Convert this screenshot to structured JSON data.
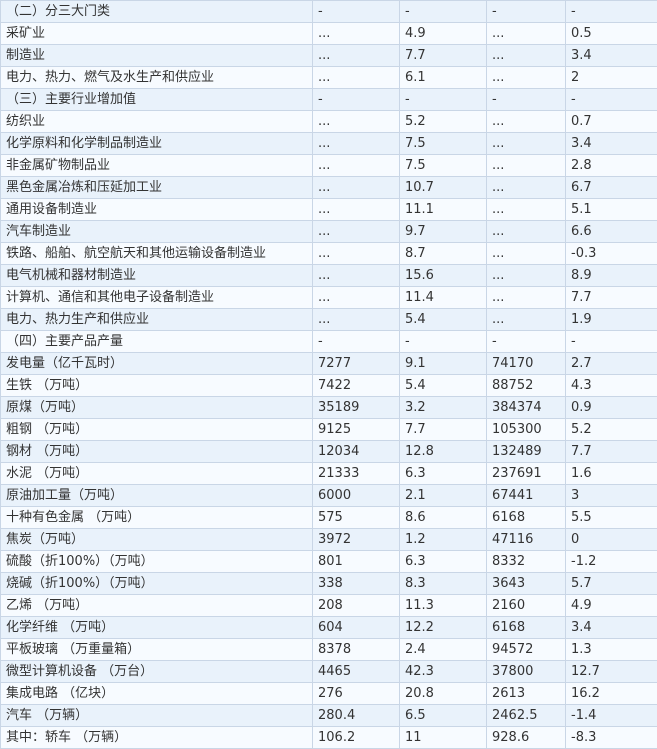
{
  "rows": [
    [
      "（二）分三大门类",
      "-",
      "-",
      "-",
      "-"
    ],
    [
      "采矿业",
      "...",
      "4.9",
      "...",
      "0.5"
    ],
    [
      "制造业",
      "...",
      "7.7",
      "...",
      "3.4"
    ],
    [
      "电力、热力、燃气及水生产和供应业",
      "...",
      "6.1",
      "...",
      "2"
    ],
    [
      "（三）主要行业增加值",
      "-",
      "-",
      "-",
      "-"
    ],
    [
      "纺织业",
      "...",
      "5.2",
      "...",
      "0.7"
    ],
    [
      "化学原料和化学制品制造业",
      "...",
      "7.5",
      "...",
      "3.4"
    ],
    [
      "非金属矿物制品业",
      "...",
      "7.5",
      "...",
      "2.8"
    ],
    [
      "黑色金属冶炼和压延加工业",
      "...",
      "10.7",
      "...",
      "6.7"
    ],
    [
      "通用设备制造业",
      "...",
      "11.1",
      "...",
      "5.1"
    ],
    [
      "汽车制造业",
      "...",
      "9.7",
      "...",
      "6.6"
    ],
    [
      "铁路、船舶、航空航天和其他运输设备制造业",
      "...",
      "8.7",
      "...",
      "-0.3"
    ],
    [
      "电气机械和器材制造业",
      "...",
      "15.6",
      "...",
      "8.9"
    ],
    [
      "计算机、通信和其他电子设备制造业",
      "...",
      "11.4",
      "...",
      "7.7"
    ],
    [
      "电力、热力生产和供应业",
      "...",
      "5.4",
      "...",
      "1.9"
    ],
    [
      "（四）主要产品产量",
      "-",
      "-",
      "-",
      "-"
    ],
    [
      "发电量（亿千瓦时）",
      "7277",
      "9.1",
      "74170",
      "2.7"
    ],
    [
      "生铁 （万吨）",
      "7422",
      "5.4",
      "88752",
      "4.3"
    ],
    [
      "原煤（万吨）",
      "35189",
      "3.2",
      "384374",
      "0.9"
    ],
    [
      "粗钢 （万吨）",
      "9125",
      "7.7",
      "105300",
      "5.2"
    ],
    [
      "钢材 （万吨）",
      "12034",
      "12.8",
      "132489",
      "7.7"
    ],
    [
      "水泥 （万吨）",
      "21333",
      "6.3",
      "237691",
      "1.6"
    ],
    [
      "原油加工量（万吨）",
      "6000",
      "2.1",
      "67441",
      "3"
    ],
    [
      "十种有色金属 （万吨）",
      "575",
      "8.6",
      "6168",
      "5.5"
    ],
    [
      "焦炭（万吨）",
      "3972",
      "1.2",
      "47116",
      "0"
    ],
    [
      "硫酸（折100%）（万吨）",
      "801",
      "6.3",
      "8332",
      "-1.2"
    ],
    [
      "烧碱（折100%）（万吨）",
      "338",
      "8.3",
      "3643",
      "5.7"
    ],
    [
      "乙烯 （万吨）",
      "208",
      "11.3",
      "2160",
      "4.9"
    ],
    [
      "化学纤维 （万吨）",
      "604",
      "12.2",
      "6168",
      "3.4"
    ],
    [
      "平板玻璃 （万重量箱）",
      "8378",
      "2.4",
      "94572",
      "1.3"
    ],
    [
      "微型计算机设备 （万台）",
      "4465",
      "42.3",
      "37800",
      "12.7"
    ],
    [
      "集成电路 （亿块）",
      "276",
      "20.8",
      "2613",
      "16.2"
    ],
    [
      "汽车 （万辆）",
      "280.4",
      "6.5",
      "2462.5",
      "-1.4"
    ],
    [
      "其中：轿车 （万辆）",
      "106.2",
      "11",
      "928.6",
      "-8.3"
    ]
  ]
}
